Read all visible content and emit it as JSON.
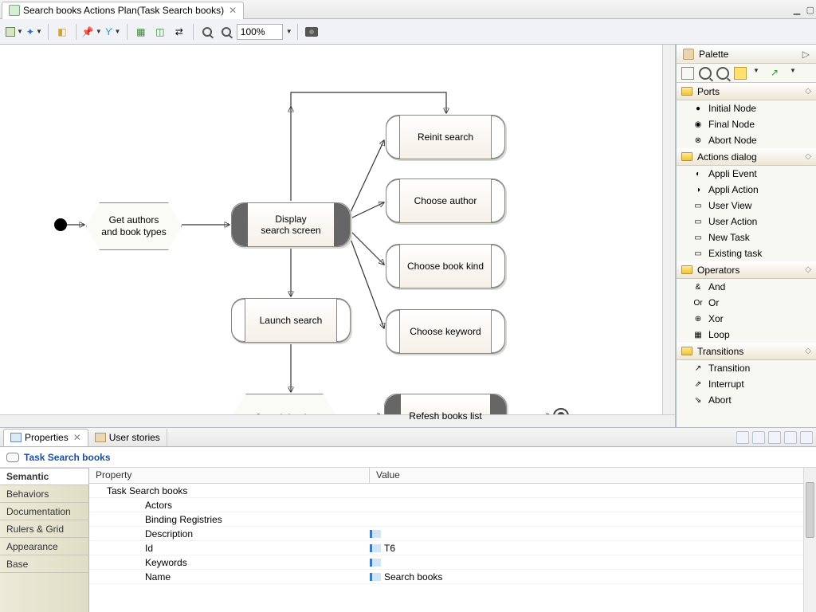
{
  "tab": {
    "title": "Search books Actions Plan(Task Search books)"
  },
  "toolbar": {
    "zoom": "100%"
  },
  "diagram": {
    "nodes": {
      "get_authors": "Get authors\nand book types",
      "display_search": "Display\nsearch screen",
      "launch_search": "Launch search",
      "search_books": "Search books",
      "reinit": "Reinit search",
      "choose_author": "Choose author",
      "choose_kind": "Choose book kind",
      "choose_keyword": "Choose keyword",
      "refresh_list": "Refesh books list"
    }
  },
  "palette": {
    "title": "Palette",
    "categories": [
      {
        "name": "Ports",
        "items": [
          "Initial Node",
          "Final Node",
          "Abort Node"
        ]
      },
      {
        "name": "Actions dialog",
        "items": [
          "Appli Event",
          "Appli Action",
          "User View",
          "User Action",
          "New Task",
          "Existing task"
        ]
      },
      {
        "name": "Operators",
        "items": [
          "And",
          "Or",
          "Xor",
          "Loop"
        ]
      },
      {
        "name": "Transitions",
        "items": [
          "Transition",
          "Interrupt",
          "Abort"
        ]
      }
    ]
  },
  "bottom": {
    "tabs": {
      "properties": "Properties",
      "user_stories": "User stories"
    },
    "header": "Task Search books",
    "left_tabs": [
      "Semantic",
      "Behaviors",
      "Documentation",
      "Rulers & Grid",
      "Appearance",
      "Base"
    ],
    "columns": {
      "property": "Property",
      "value": "Value"
    },
    "rows": [
      {
        "p": "Task Search books",
        "v": "",
        "child": false
      },
      {
        "p": "Actors",
        "v": "",
        "child": true
      },
      {
        "p": "Binding Registries",
        "v": "",
        "child": true
      },
      {
        "p": "Description",
        "v": "",
        "child": true,
        "icon": true
      },
      {
        "p": "Id",
        "v": "T6",
        "child": true,
        "icon": true
      },
      {
        "p": "Keywords",
        "v": "",
        "child": true,
        "icon": true
      },
      {
        "p": "Name",
        "v": "Search books",
        "child": true,
        "icon": true
      }
    ]
  }
}
